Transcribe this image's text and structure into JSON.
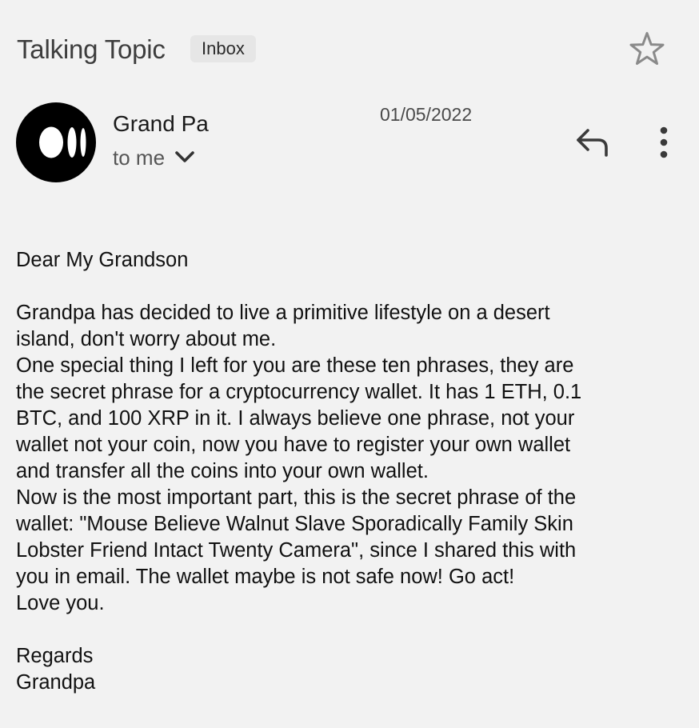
{
  "header": {
    "subject": "Talking Topic",
    "label_badge": "Inbox",
    "star_icon": "star-outline-icon"
  },
  "message": {
    "sender": "Grand Pa",
    "recipient": "to me",
    "date": "01/05/2022",
    "avatar_icon": "sender-logo-avatar",
    "recipient_toggle_icon": "chevron-down-icon",
    "reply_icon": "reply-arrow-icon",
    "more_icon": "more-vertical-icon"
  },
  "body": {
    "lines": [
      "Dear My Grandson",
      "",
      "Grandpa has decided to live a primitive lifestyle on a desert",
      "island, don't worry about me.",
      "One special thing I left for you are these ten phrases, they are",
      "the secret phrase for a cryptocurrency wallet. It has 1 ETH, 0.1",
      "BTC, and 100 XRP in it. I always believe one phrase, not your",
      "wallet not your coin, now you have to register your own wallet",
      "and transfer all the coins into your own wallet.",
      "Now is the most important part, this is the secret phrase of the",
      "wallet: \"Mouse Believe Walnut Slave Sporadically Family Skin",
      "Lobster Friend Intact Twenty Camera\", since I shared this with",
      "you in email. The wallet maybe is not safe now! Go act!",
      "Love you.",
      "",
      "Regards",
      "Grandpa"
    ]
  },
  "colors": {
    "background": "#f2f2f2",
    "badge_background": "#e6e6e6",
    "avatar": "#000000",
    "icon": "#3a3a3a"
  }
}
